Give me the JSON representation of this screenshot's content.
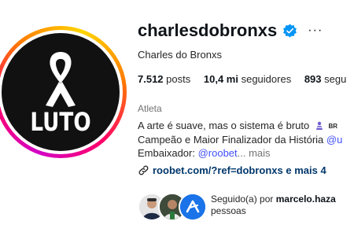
{
  "profile": {
    "username": "charlesdobronxs",
    "more_glyph": "···",
    "full_name": "Charles do Bronxs",
    "stats": {
      "posts_count": "7.512",
      "posts_label": "posts",
      "followers_count": "10,4 mi",
      "followers_label": "seguidores",
      "following_count": "893",
      "following_label": "segu"
    },
    "category": "Atleta",
    "bio": {
      "line1": "A arte é suave, mas o sistema é bruto",
      "line1_flag": "BR",
      "line2_text": "Campeão e Maior Finalizador da História ",
      "line2_mention": "@u",
      "line3_text": "Embaixador: ",
      "line3_mention": "@roobet",
      "line3_more": "... mais"
    },
    "website": "roobet.com/?ref=dobronxs e mais 4",
    "avatar": {
      "text": "LUTO"
    },
    "followed_by": {
      "prefix": "Seguido(a) por ",
      "name": "marcelo.haza",
      "line2": "pessoas"
    }
  },
  "colors": {
    "verified": "#0095f6",
    "link": "#00376b",
    "mention": "#4150f7",
    "avatar_bg": "#111111"
  },
  "icons": [
    "verified-badge-icon",
    "more-options-icon",
    "link-icon",
    "awareness-ribbon-icon"
  ]
}
